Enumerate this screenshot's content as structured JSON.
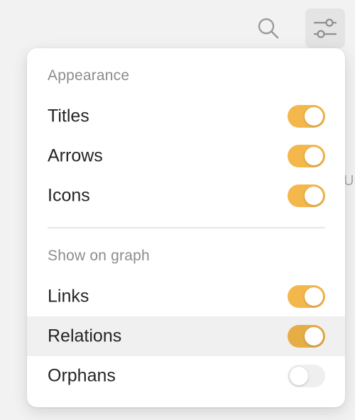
{
  "toolbar": {
    "search_icon": "search-icon",
    "settings_icon": "sliders-icon"
  },
  "edge_text": "Ur",
  "menu": {
    "appearance": {
      "title": "Appearance",
      "items": [
        {
          "label": "Titles",
          "enabled": true
        },
        {
          "label": "Arrows",
          "enabled": true
        },
        {
          "label": "Icons",
          "enabled": true
        }
      ]
    },
    "show_on_graph": {
      "title": "Show on graph",
      "items": [
        {
          "label": "Links",
          "enabled": true
        },
        {
          "label": "Relations",
          "enabled": true
        },
        {
          "label": "Orphans",
          "enabled": false
        }
      ]
    }
  },
  "colors": {
    "toggle_on": "#f4b74b",
    "toggle_off": "#efefef",
    "hover_row": "#f0f0f0",
    "section_title": "#8c8c8c"
  }
}
